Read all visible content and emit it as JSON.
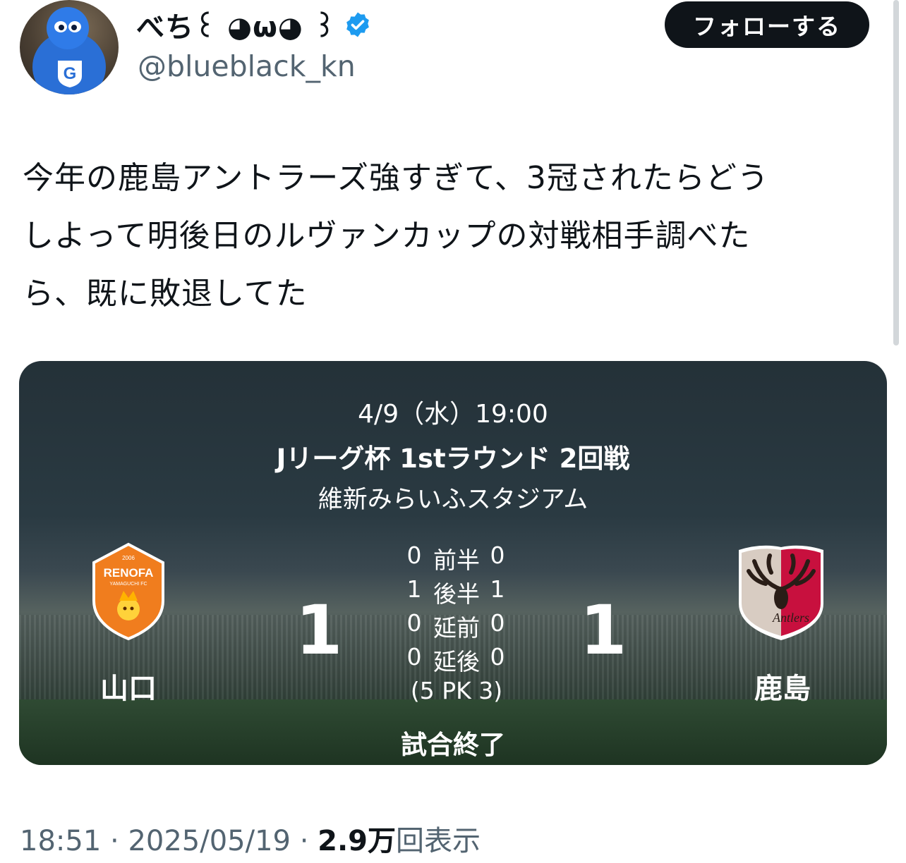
{
  "author": {
    "display_name": "べち꒰ ◕ω◕ ꒱",
    "handle": "@blueblack_kn",
    "verified": true,
    "avatar_icon": "blue-mascot-avatar-icon"
  },
  "follow_label": "フォローする",
  "tweet_lines": [
    "今年の鹿島アントラーズ強すぎて、3冠されたらどう",
    "しよって明後日のルヴァンカップの対戦相手調べた",
    "ら、既に敗退してた"
  ],
  "match": {
    "date": "4/9（水）19:00",
    "competition": "Jリーグ杯 1stラウンド 2回戦",
    "venue": "維新みらいふスタジアム",
    "home_team": "山口",
    "away_team": "鹿島",
    "home_score": "1",
    "away_score": "1",
    "periods": [
      {
        "home": "0",
        "label": "前半",
        "away": "0"
      },
      {
        "home": "1",
        "label": "後半",
        "away": "1"
      },
      {
        "home": "0",
        "label": "延前",
        "away": "0"
      },
      {
        "home": "0",
        "label": "延後",
        "away": "0"
      }
    ],
    "pk": "(5  PK  3)",
    "status": "試合終了",
    "home_crest_text": "RENOFA",
    "home_crest_sub": "YAMAGUCHI FC",
    "home_crest_year": "2006",
    "away_crest_text": "Antlers"
  },
  "meta": {
    "time": "18:51",
    "date": "2025/05/19",
    "views_value": "2.9",
    "views_unit": "万",
    "views_label": "回表示",
    "sep": "·"
  },
  "colors": {
    "follow_bg": "#0f1419",
    "secondary_text": "#536471",
    "verified_blue": "#1d9bf0",
    "renofa_orange": "#f07d1e",
    "antlers_red": "#c8103e"
  }
}
